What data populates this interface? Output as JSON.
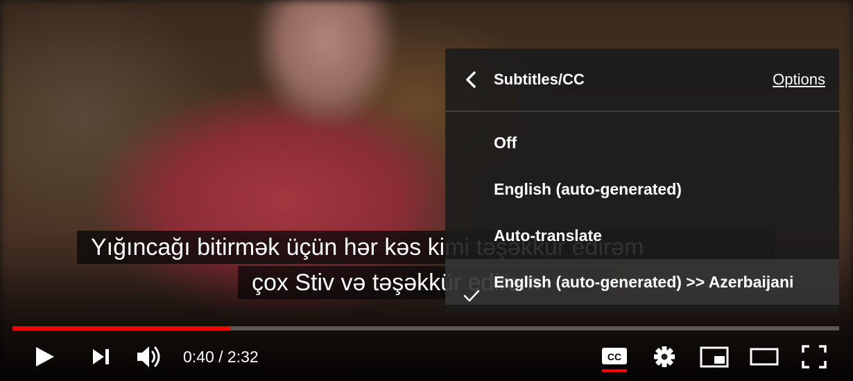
{
  "captions": {
    "line1": "Yığıncağı bitirmək üçün hər kəs kimi təşəkkür edirəm",
    "line2": "çox Stiv və təşəkkür edirəm"
  },
  "menu": {
    "title": "Subtitles/CC",
    "options_label": "Options",
    "items": [
      {
        "label": "Off",
        "selected": false
      },
      {
        "label": "English (auto-generated)",
        "selected": false
      },
      {
        "label": "Auto-translate",
        "selected": false
      },
      {
        "label": "English (auto-generated) >> Azerbaijani",
        "selected": true
      }
    ]
  },
  "player": {
    "current_time": "0:40",
    "duration": "2:32",
    "time_display": "0:40 / 2:32",
    "progress_fraction": 0.263,
    "accent_color": "#ff0000",
    "icons": [
      "play-icon",
      "next-icon",
      "volume-icon",
      "cc-icon",
      "settings-gear-icon",
      "miniplayer-icon",
      "theater-mode-icon",
      "fullscreen-icon"
    ]
  }
}
